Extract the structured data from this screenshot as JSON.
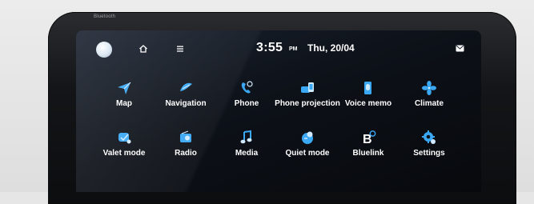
{
  "device": {
    "brand_label": "Bluetooth"
  },
  "status": {
    "time": "3:55",
    "ampm": "PM",
    "date": "Thu, 20/04"
  },
  "apps": [
    {
      "label": "Map",
      "icon": "map-icon"
    },
    {
      "label": "Navigation",
      "icon": "navigation-icon"
    },
    {
      "label": "Phone",
      "icon": "phone-icon"
    },
    {
      "label": "Phone projection",
      "icon": "phone-projection-icon"
    },
    {
      "label": "Voice memo",
      "icon": "voice-memo-icon"
    },
    {
      "label": "Climate",
      "icon": "climate-icon"
    },
    {
      "label": "Valet mode",
      "icon": "valet-mode-icon"
    },
    {
      "label": "Radio",
      "icon": "radio-icon"
    },
    {
      "label": "Media",
      "icon": "media-icon"
    },
    {
      "label": "Quiet mode",
      "icon": "quiet-mode-icon"
    },
    {
      "label": "Bluelink",
      "icon": "bluelink-icon"
    },
    {
      "label": "Settings",
      "icon": "settings-icon"
    }
  ],
  "colors": {
    "icon_blue": "#3aa8f5",
    "icon_light": "#cfe9ff",
    "text": "#ffffff",
    "screen_bg": "#0d1118"
  }
}
